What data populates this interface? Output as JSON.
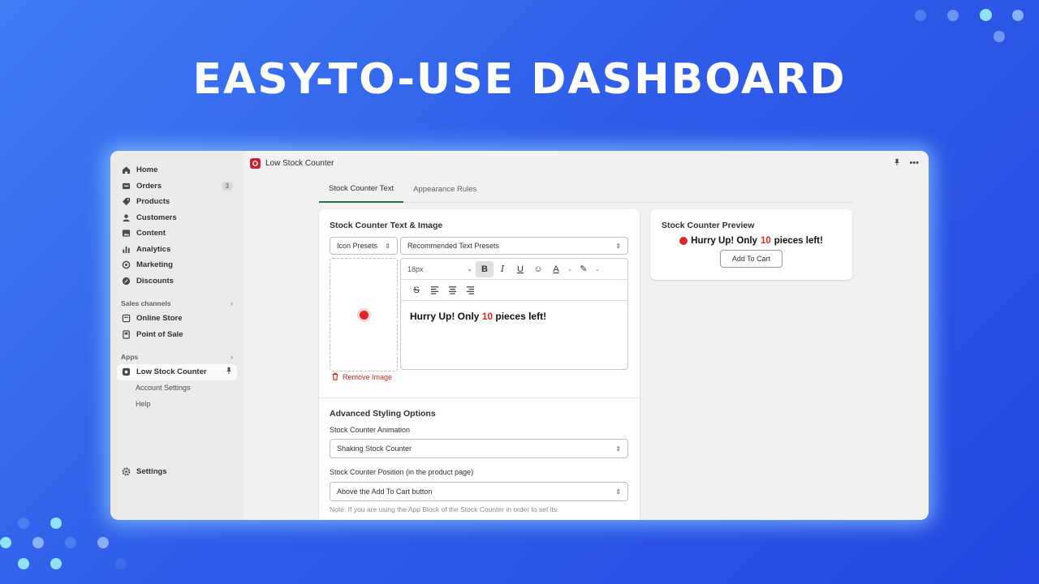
{
  "headline": "EASY-TO-USE DASHBOARD",
  "colors": {
    "accent_red": "#e1262a",
    "tab_underline": "#2c6e49",
    "bg_blue": "#2f5de8"
  },
  "sidebar": {
    "items": [
      {
        "label": "Home",
        "icon": "home-icon"
      },
      {
        "label": "Orders",
        "icon": "orders-icon",
        "badge": "3"
      },
      {
        "label": "Products",
        "icon": "tag-icon"
      },
      {
        "label": "Customers",
        "icon": "person-icon"
      },
      {
        "label": "Content",
        "icon": "content-icon"
      },
      {
        "label": "Analytics",
        "icon": "chart-icon"
      },
      {
        "label": "Marketing",
        "icon": "target-icon"
      },
      {
        "label": "Discounts",
        "icon": "discount-icon"
      }
    ],
    "sales_channels_label": "Sales channels",
    "sales_channels": [
      {
        "label": "Online Store",
        "icon": "store-icon"
      },
      {
        "label": "Point of Sale",
        "icon": "pos-icon"
      }
    ],
    "apps_label": "Apps",
    "app": {
      "label": "Low Stock Counter",
      "icon": "app-icon"
    },
    "app_subitems": [
      "Account Settings",
      "Help"
    ],
    "settings_label": "Settings"
  },
  "topbar": {
    "title": "Low Stock Counter"
  },
  "tabs": [
    "Stock Counter Text",
    "Appearance Rules"
  ],
  "editor_card": {
    "title": "Stock Counter Text & Image",
    "icon_presets": "Icon Presets",
    "text_presets": "Recommended Text Presets",
    "font_size": "18px",
    "text_prefix": "Hurry Up! Only",
    "text_number": "10",
    "text_suffix": "pieces left!",
    "remove_image": "Remove Image",
    "advanced_title": "Advanced Styling Options",
    "animation_label": "Stock Counter Animation",
    "animation_value": "Shaking Stock Counter",
    "position_label": "Stock Counter Position (in the product page)",
    "position_value": "Above the Add To Cart button",
    "note": "Note: If you are using the App Block of the Stock Counter in order to set its"
  },
  "preview_card": {
    "title": "Stock Counter Preview",
    "text_prefix": "Hurry Up! Only",
    "text_number": "10",
    "text_suffix": "pieces left!",
    "button_label": "Add To Cart"
  }
}
